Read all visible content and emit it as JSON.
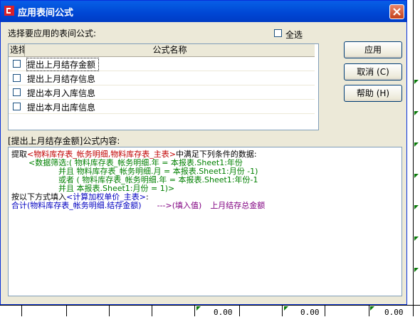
{
  "window": {
    "title": "应用表间公式"
  },
  "select_label": "选择要应用的表间公式:",
  "select_all_label": "全选",
  "list": {
    "columns": [
      "选择",
      "公式名称"
    ],
    "rows": [
      {
        "name": "提出上月结存金额",
        "checked": false,
        "selected": true
      },
      {
        "name": "提出上月结存信息",
        "checked": false,
        "selected": false
      },
      {
        "name": "提出本月入库信息",
        "checked": false,
        "selected": false
      },
      {
        "name": "提出本月出库信息",
        "checked": false,
        "selected": false
      }
    ]
  },
  "buttons": {
    "apply": "应用",
    "cancel": "取消 (C)",
    "help": "帮助 (H)"
  },
  "content_label": "[提出上月结存金额]公式内容:",
  "formula": {
    "line1_prefix": "提取",
    "line1_tables": "<物料库存表_帐务明细,物料库存表_主表>",
    "line1_suffix": "中满足下列条件的数据:",
    "line2": "<数据筛选:( 物料库存表_帐务明细.年 = 本报表.Sheet1:年份",
    "line3": "并且 物料库存表_帐务明细.月 = 本报表.Sheet1:月份 -1)",
    "line4": "或者 ( 物料库存表_帐务明细.年 = 本报表.Sheet1:年份-1",
    "line5": "并且 本报表.Sheet1:月份 = 1)>",
    "line6_prefix": "按以下方式填入",
    "line6_target": "<计算加权单价_主表>",
    "line6_suffix": ":",
    "line7_expr": "合计(物料库存表_帐务明细.结存金额)",
    "line7_arrow": "--->(填入值)",
    "line7_field": "上月结存总金额"
  },
  "background": {
    "cell_values": [
      "0.00",
      "0.00",
      "0.00"
    ]
  },
  "colors": {
    "titlebar": "#0054e3",
    "dialog_bg": "#ece9d8",
    "table_name": "#c00000",
    "filter": "#008000",
    "target": "#0000c0",
    "field": "#800080"
  }
}
